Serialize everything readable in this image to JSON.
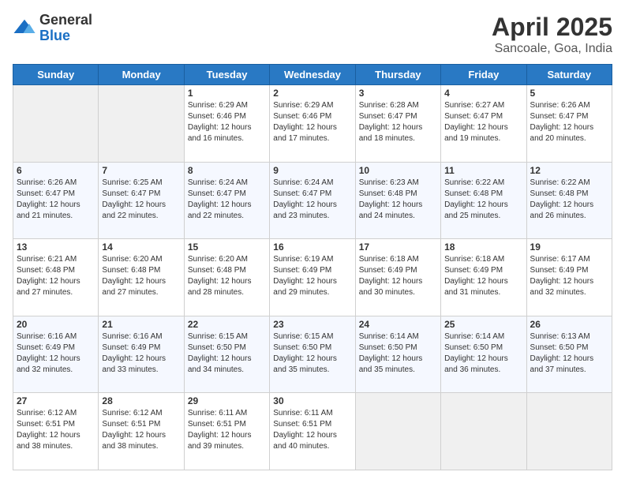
{
  "header": {
    "logo": {
      "general": "General",
      "blue": "Blue"
    },
    "title": "April 2025",
    "subtitle": "Sancoale, Goa, India"
  },
  "calendar": {
    "days_of_week": [
      "Sunday",
      "Monday",
      "Tuesday",
      "Wednesday",
      "Thursday",
      "Friday",
      "Saturday"
    ],
    "weeks": [
      [
        {
          "day": null
        },
        {
          "day": null
        },
        {
          "day": 1,
          "sunrise": "6:29 AM",
          "sunset": "6:46 PM",
          "daylight": "12 hours and 16 minutes."
        },
        {
          "day": 2,
          "sunrise": "6:29 AM",
          "sunset": "6:46 PM",
          "daylight": "12 hours and 17 minutes."
        },
        {
          "day": 3,
          "sunrise": "6:28 AM",
          "sunset": "6:47 PM",
          "daylight": "12 hours and 18 minutes."
        },
        {
          "day": 4,
          "sunrise": "6:27 AM",
          "sunset": "6:47 PM",
          "daylight": "12 hours and 19 minutes."
        },
        {
          "day": 5,
          "sunrise": "6:26 AM",
          "sunset": "6:47 PM",
          "daylight": "12 hours and 20 minutes."
        }
      ],
      [
        {
          "day": 6,
          "sunrise": "6:26 AM",
          "sunset": "6:47 PM",
          "daylight": "12 hours and 21 minutes."
        },
        {
          "day": 7,
          "sunrise": "6:25 AM",
          "sunset": "6:47 PM",
          "daylight": "12 hours and 22 minutes."
        },
        {
          "day": 8,
          "sunrise": "6:24 AM",
          "sunset": "6:47 PM",
          "daylight": "12 hours and 22 minutes."
        },
        {
          "day": 9,
          "sunrise": "6:24 AM",
          "sunset": "6:47 PM",
          "daylight": "12 hours and 23 minutes."
        },
        {
          "day": 10,
          "sunrise": "6:23 AM",
          "sunset": "6:48 PM",
          "daylight": "12 hours and 24 minutes."
        },
        {
          "day": 11,
          "sunrise": "6:22 AM",
          "sunset": "6:48 PM",
          "daylight": "12 hours and 25 minutes."
        },
        {
          "day": 12,
          "sunrise": "6:22 AM",
          "sunset": "6:48 PM",
          "daylight": "12 hours and 26 minutes."
        }
      ],
      [
        {
          "day": 13,
          "sunrise": "6:21 AM",
          "sunset": "6:48 PM",
          "daylight": "12 hours and 27 minutes."
        },
        {
          "day": 14,
          "sunrise": "6:20 AM",
          "sunset": "6:48 PM",
          "daylight": "12 hours and 27 minutes."
        },
        {
          "day": 15,
          "sunrise": "6:20 AM",
          "sunset": "6:48 PM",
          "daylight": "12 hours and 28 minutes."
        },
        {
          "day": 16,
          "sunrise": "6:19 AM",
          "sunset": "6:49 PM",
          "daylight": "12 hours and 29 minutes."
        },
        {
          "day": 17,
          "sunrise": "6:18 AM",
          "sunset": "6:49 PM",
          "daylight": "12 hours and 30 minutes."
        },
        {
          "day": 18,
          "sunrise": "6:18 AM",
          "sunset": "6:49 PM",
          "daylight": "12 hours and 31 minutes."
        },
        {
          "day": 19,
          "sunrise": "6:17 AM",
          "sunset": "6:49 PM",
          "daylight": "12 hours and 32 minutes."
        }
      ],
      [
        {
          "day": 20,
          "sunrise": "6:16 AM",
          "sunset": "6:49 PM",
          "daylight": "12 hours and 32 minutes."
        },
        {
          "day": 21,
          "sunrise": "6:16 AM",
          "sunset": "6:49 PM",
          "daylight": "12 hours and 33 minutes."
        },
        {
          "day": 22,
          "sunrise": "6:15 AM",
          "sunset": "6:50 PM",
          "daylight": "12 hours and 34 minutes."
        },
        {
          "day": 23,
          "sunrise": "6:15 AM",
          "sunset": "6:50 PM",
          "daylight": "12 hours and 35 minutes."
        },
        {
          "day": 24,
          "sunrise": "6:14 AM",
          "sunset": "6:50 PM",
          "daylight": "12 hours and 35 minutes."
        },
        {
          "day": 25,
          "sunrise": "6:14 AM",
          "sunset": "6:50 PM",
          "daylight": "12 hours and 36 minutes."
        },
        {
          "day": 26,
          "sunrise": "6:13 AM",
          "sunset": "6:50 PM",
          "daylight": "12 hours and 37 minutes."
        }
      ],
      [
        {
          "day": 27,
          "sunrise": "6:12 AM",
          "sunset": "6:51 PM",
          "daylight": "12 hours and 38 minutes."
        },
        {
          "day": 28,
          "sunrise": "6:12 AM",
          "sunset": "6:51 PM",
          "daylight": "12 hours and 38 minutes."
        },
        {
          "day": 29,
          "sunrise": "6:11 AM",
          "sunset": "6:51 PM",
          "daylight": "12 hours and 39 minutes."
        },
        {
          "day": 30,
          "sunrise": "6:11 AM",
          "sunset": "6:51 PM",
          "daylight": "12 hours and 40 minutes."
        },
        {
          "day": null
        },
        {
          "day": null
        },
        {
          "day": null
        }
      ]
    ]
  }
}
